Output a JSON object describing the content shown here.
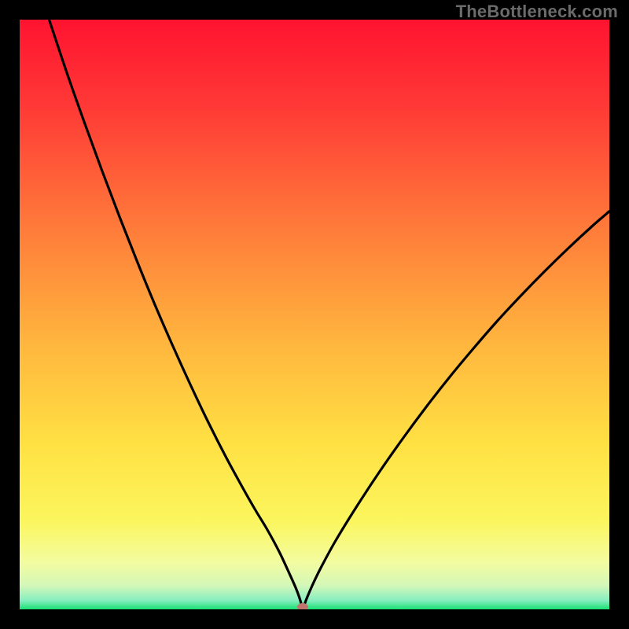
{
  "watermark": "TheBottleneck.com",
  "colors": {
    "marker": "#c0746e",
    "curve_stroke": "#000000"
  },
  "chart_data": {
    "type": "line",
    "title": "",
    "xlabel": "",
    "ylabel": "",
    "xlim": [
      0,
      100
    ],
    "ylim": [
      0,
      100
    ],
    "grid": false,
    "vertex": {
      "x": 48,
      "y": 0
    },
    "series": [
      {
        "name": "left-branch",
        "x": [
          5,
          8,
          11,
          14,
          17,
          20,
          23,
          26,
          29,
          32,
          35,
          38,
          40,
          42,
          44,
          45.5,
          46.8,
          47.5,
          48
        ],
        "y": [
          100,
          91,
          82.5,
          74.3,
          66.4,
          58.8,
          51.5,
          44.6,
          38.0,
          31.7,
          25.8,
          20.3,
          16.8,
          13.5,
          9.8,
          6.6,
          3.7,
          1.8,
          0
        ]
      },
      {
        "name": "right-branch",
        "x": [
          48,
          48.7,
          49.6,
          51,
          53.5,
          57,
          61,
          65,
          69,
          73,
          77,
          81,
          85,
          89,
          93,
          97,
          100
        ],
        "y": [
          0,
          1.9,
          4.0,
          6.9,
          11.5,
          17.2,
          23.3,
          29.0,
          34.4,
          39.5,
          44.3,
          48.9,
          53.2,
          57.3,
          61.2,
          64.9,
          67.5
        ]
      }
    ]
  }
}
